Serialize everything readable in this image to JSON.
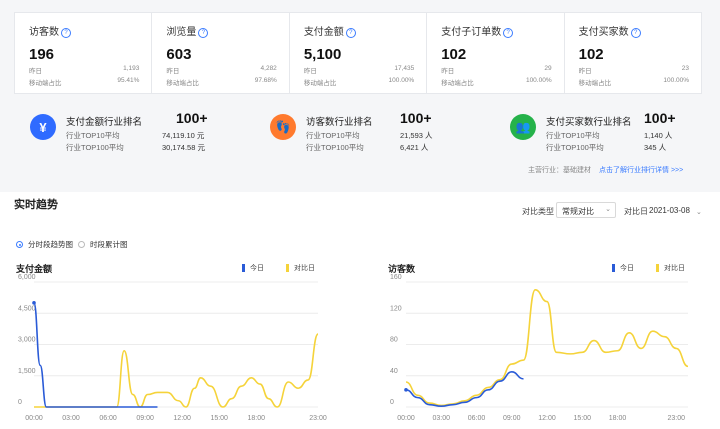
{
  "stats": [
    {
      "label": "访客数",
      "value": "196",
      "prev_label": "昨日",
      "prev_value": "1,193",
      "mobile_label": "移动端占比",
      "mobile_value": "95.41%"
    },
    {
      "label": "浏览量",
      "value": "603",
      "prev_label": "昨日",
      "prev_value": "4,282",
      "mobile_label": "移动端占比",
      "mobile_value": "97.68%"
    },
    {
      "label": "支付金额",
      "value": "5,100",
      "prev_label": "昨日",
      "prev_value": "17,435",
      "mobile_label": "移动端占比",
      "mobile_value": "100.00%"
    },
    {
      "label": "支付子订单数",
      "value": "102",
      "prev_label": "昨日",
      "prev_value": "29",
      "mobile_label": "移动端占比",
      "mobile_value": "100.00%"
    },
    {
      "label": "支付买家数",
      "value": "102",
      "prev_label": "昨日",
      "prev_value": "23",
      "mobile_label": "移动端占比",
      "mobile_value": "100.00%"
    }
  ],
  "ranks": [
    {
      "icon": "¥",
      "title": "支付金额行业排名",
      "rank": "100+",
      "top10_label": "行业TOP10平均",
      "top10_value": "74,119.10 元",
      "top100_label": "行业TOP100平均",
      "top100_value": "30,174.58 元",
      "color": "#2f6bff"
    },
    {
      "icon": "👣",
      "title": "访客数行业排名",
      "rank": "100+",
      "top10_label": "行业TOP10平均",
      "top10_value": "21,593 人",
      "top100_label": "行业TOP100平均",
      "top100_value": "6,421 人",
      "color": "#ff7a2e"
    },
    {
      "icon": "👥",
      "title": "支付买家数行业排名",
      "rank": "100+",
      "top10_label": "行业TOP10平均",
      "top10_value": "1,140 人",
      "top100_label": "行业TOP100平均",
      "top100_value": "345 人",
      "color": "#25b24a"
    }
  ],
  "industry": {
    "label": "主营行业：",
    "value": "基础建材",
    "link": "点击了解行业排行详情 >>>"
  },
  "section_title": "实时趋势",
  "compare": {
    "type_label": "对比类型",
    "type_value": "常规对比",
    "date_label": "对比日",
    "date_value": "2021-03-08"
  },
  "view_modes": [
    "分时段趋势图",
    "时段累计图"
  ],
  "legend": {
    "today": "今日",
    "compare": "对比日"
  },
  "colors": {
    "today": "#2a5bd7",
    "compare": "#f5d33a",
    "primary": "#3b7cff"
  },
  "chart_data": [
    {
      "type": "line",
      "title": "支付金额",
      "x_ticks": [
        "00:00",
        "03:00",
        "06:00",
        "09:00",
        "12:00",
        "15:00",
        "18:00",
        "23:00"
      ],
      "y_ticks": [
        "0",
        "1,500",
        "3,000",
        "4,500",
        "6,000"
      ],
      "ylim": [
        0,
        6000
      ],
      "series": [
        {
          "name": "今日",
          "values": [
            [
              0,
              5000
            ],
            [
              0.5,
              2000
            ],
            [
              1,
              0
            ],
            [
              3,
              0
            ],
            [
              6,
              0
            ],
            [
              9,
              0
            ],
            [
              10,
              0
            ]
          ]
        },
        {
          "name": "对比日",
          "values": [
            [
              0,
              0
            ],
            [
              6,
              0
            ],
            [
              6.7,
              0
            ],
            [
              7.3,
              2700
            ],
            [
              8,
              600
            ],
            [
              8.6,
              0
            ],
            [
              9.2,
              600
            ],
            [
              10,
              700
            ],
            [
              10.8,
              700
            ],
            [
              11.7,
              300
            ],
            [
              12.3,
              0
            ],
            [
              13,
              900
            ],
            [
              13.5,
              1400
            ],
            [
              14.3,
              1000
            ],
            [
              15.3,
              0
            ],
            [
              16,
              400
            ],
            [
              16.8,
              1000
            ],
            [
              17.6,
              1400
            ],
            [
              18.3,
              1100
            ],
            [
              19,
              400
            ],
            [
              19.7,
              0
            ],
            [
              20.6,
              1200
            ],
            [
              21.4,
              900
            ],
            [
              22.2,
              1300
            ],
            [
              23,
              3500
            ]
          ]
        }
      ]
    },
    {
      "type": "line",
      "title": "访客数",
      "x_ticks": [
        "00:00",
        "03:00",
        "06:00",
        "09:00",
        "12:00",
        "15:00",
        "18:00",
        "23:00"
      ],
      "y_ticks": [
        "0",
        "40",
        "80",
        "120",
        "160"
      ],
      "ylim": [
        0,
        160
      ],
      "series": [
        {
          "name": "今日",
          "values": [
            [
              0,
              22
            ],
            [
              1,
              12
            ],
            [
              2,
              3
            ],
            [
              3,
              1
            ],
            [
              4,
              3
            ],
            [
              5,
              6
            ],
            [
              6,
              12
            ],
            [
              7,
              22
            ],
            [
              8,
              33
            ],
            [
              9,
              45
            ],
            [
              10,
              36
            ]
          ]
        },
        {
          "name": "对比日",
          "values": [
            [
              0,
              32
            ],
            [
              1,
              15
            ],
            [
              2,
              5
            ],
            [
              3,
              2
            ],
            [
              4,
              4
            ],
            [
              5,
              8
            ],
            [
              6,
              15
            ],
            [
              7,
              25
            ],
            [
              8,
              35
            ],
            [
              9,
              55
            ],
            [
              10,
              60
            ],
            [
              11,
              150
            ],
            [
              12,
              135
            ],
            [
              12.8,
              70
            ],
            [
              14,
              68
            ],
            [
              15,
              70
            ],
            [
              16,
              85
            ],
            [
              17,
              70
            ],
            [
              18,
              72
            ],
            [
              19,
              95
            ],
            [
              20,
              75
            ],
            [
              21,
              97
            ],
            [
              22,
              90
            ],
            [
              23,
              75
            ],
            [
              24,
              52
            ]
          ]
        }
      ]
    }
  ]
}
